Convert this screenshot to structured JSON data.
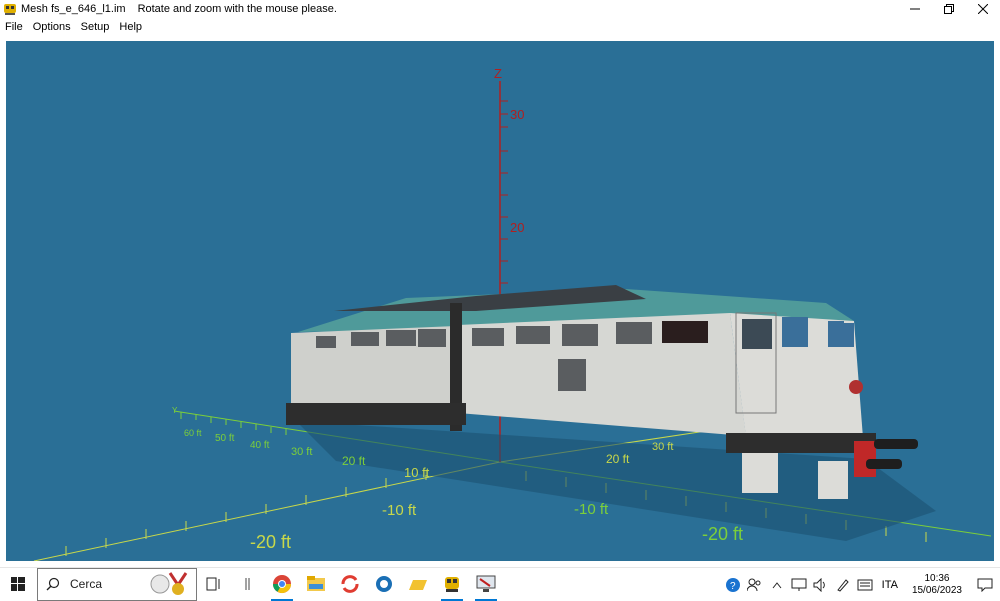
{
  "window": {
    "title": "Mesh fs_e_646_l1.im",
    "message": "Rotate and zoom with the mouse please."
  },
  "menu": [
    "File",
    "Options",
    "Setup",
    "Help"
  ],
  "viewer": {
    "axis_label": "Z",
    "z_ticks": [
      "30",
      "20"
    ],
    "y_ft_labels": [
      "60 ft",
      "50 ft",
      "40 ft",
      "30 ft",
      "20 ft",
      "10 ft"
    ],
    "x_pos_labels": [
      "20 ft",
      "30 ft"
    ],
    "x_neg_labels": [
      "-10 ft",
      "-20 ft"
    ],
    "y_neg_labels": [
      "-10 ft",
      "-20 ft"
    ],
    "background": "#2a6f96",
    "grid_color_y": "#7ccf3a",
    "grid_color_x": "#c8d84a",
    "axis_color": "#b02020"
  },
  "taskbar": {
    "search_label": "Cerca",
    "language": "ITA",
    "time": "10:36",
    "date": "15/06/2023"
  }
}
